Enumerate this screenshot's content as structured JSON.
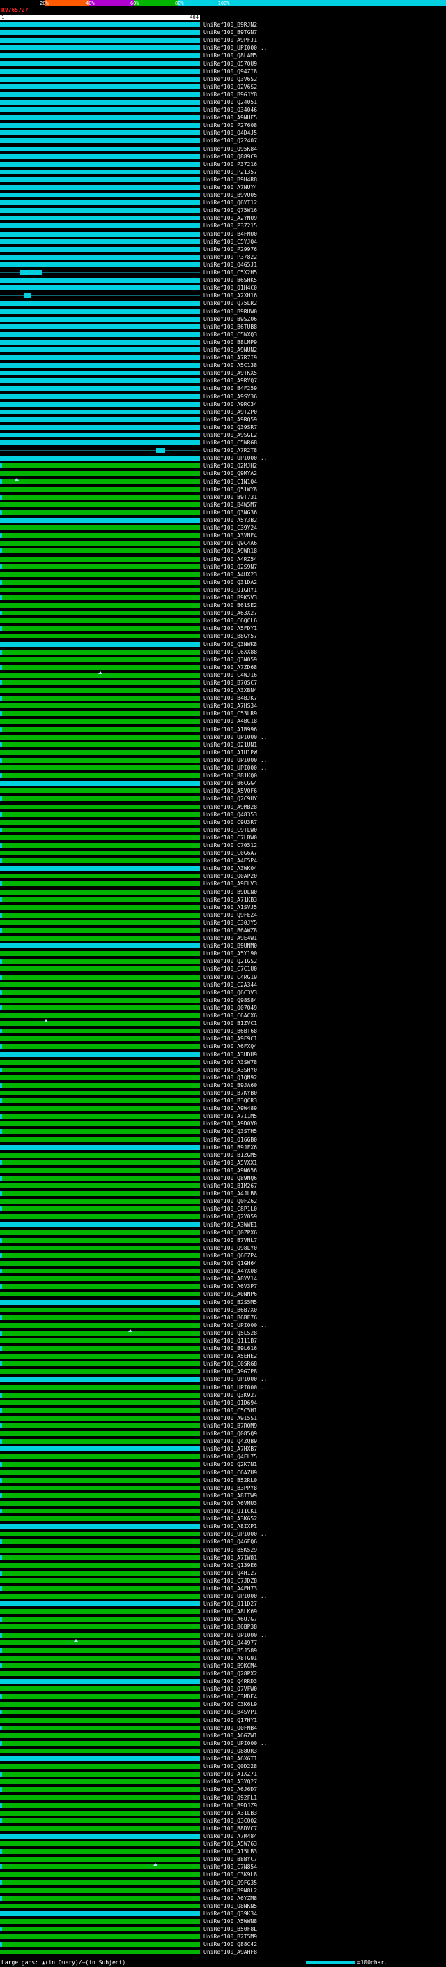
{
  "title": {
    "query_id": "RV765727",
    "query_start": "1",
    "query_end": "404"
  },
  "query_length": 404,
  "color_key": {
    "segments": [
      {
        "label": "20%",
        "color": "#000000"
      },
      {
        "label": "~40%",
        "color": "#ff5a00"
      },
      {
        "label": "~60%",
        "color": "#b000d0"
      },
      {
        "label": "~80%",
        "color": "#00b400"
      },
      {
        "label": "~100%",
        "color": "#00d0e0"
      }
    ]
  },
  "colors": {
    "c": "#00d0e0",
    "g": "#00b400",
    "m": "#c000c0",
    "n": "#0a6a74"
  },
  "footer": {
    "gap_legend": "Large gaps: ▲(in Query)/—(in Subject)",
    "scale_label": "=100char.",
    "scale_chars": 100
  },
  "rows": [
    {
      "id": "UniRef100_B9RJN2",
      "c": "c"
    },
    {
      "id": "UniRef100_B9TGN7",
      "c": "c"
    },
    {
      "id": "UniRef100_A9PFJ1",
      "c": "c"
    },
    {
      "id": "UniRef100_UPI000...",
      "c": "c"
    },
    {
      "id": "UniRef100_Q8LAM5",
      "c": "c"
    },
    {
      "id": "UniRef100_Q57OU9",
      "c": "c"
    },
    {
      "id": "UniRef100_Q94ZI8",
      "c": "c"
    },
    {
      "id": "UniRef100_Q3V6S2",
      "c": "c"
    },
    {
      "id": "UniRef100_Q2V6S2",
      "c": "c"
    },
    {
      "id": "UniRef100_B9GJY8",
      "c": "c"
    },
    {
      "id": "UniRef100_Q24051",
      "c": "c"
    },
    {
      "id": "UniRef100_Q34046",
      "c": "c"
    },
    {
      "id": "UniRef100_A9NUF5",
      "c": "c"
    },
    {
      "id": "UniRef100_P27608",
      "c": "c"
    },
    {
      "id": "UniRef100_Q4D4J5",
      "c": "c"
    },
    {
      "id": "UniRef100_Q22407",
      "c": "c"
    },
    {
      "id": "UniRef100_Q95K84",
      "c": "c"
    },
    {
      "id": "UniRef100_Q889C9",
      "c": "c"
    },
    {
      "id": "UniRef100_P37216",
      "c": "c"
    },
    {
      "id": "UniRef100_P21357",
      "c": "c"
    },
    {
      "id": "UniRef100_B9H4R8",
      "c": "c"
    },
    {
      "id": "UniRef100_A7NUY4",
      "c": "c"
    },
    {
      "id": "UniRef100_B9VU05",
      "c": "c"
    },
    {
      "id": "UniRef100_Q6YT12",
      "c": "c"
    },
    {
      "id": "UniRef100_Q75W16",
      "c": "c"
    },
    {
      "id": "UniRef100_A2YNU9",
      "c": "c"
    },
    {
      "id": "UniRef100_P37215",
      "c": "c"
    },
    {
      "id": "UniRef100_B4FMU0",
      "c": "c"
    },
    {
      "id": "UniRef100_C5YJQ4",
      "c": "c"
    },
    {
      "id": "UniRef100_P29976",
      "c": "c"
    },
    {
      "id": "UniRef100_P37822",
      "c": "c"
    },
    {
      "id": "UniRef100_Q4G5J1",
      "c": "c"
    },
    {
      "id": "UniRef100_C5X2H5",
      "c": "c",
      "s": [
        [
          1,
          39,
          "n"
        ],
        [
          40,
          85,
          "c"
        ],
        [
          86,
          404,
          "n"
        ]
      ]
    },
    {
      "id": "UniRef100_B6SHK5",
      "c": "c"
    },
    {
      "id": "UniRef100_Q1H4C0",
      "c": "c"
    },
    {
      "id": "UniRef100_A2XH16",
      "c": "c",
      "s": [
        [
          1,
          48,
          "n"
        ],
        [
          49,
          62,
          "c"
        ],
        [
          63,
          404,
          "n"
        ]
      ]
    },
    {
      "id": "UniRef100_Q75LR2",
      "c": "c"
    },
    {
      "id": "UniRef100_B9RUW0",
      "c": "c"
    },
    {
      "id": "UniRef100_B9SZ06",
      "c": "c"
    },
    {
      "id": "UniRef100_B6TUB8",
      "c": "c"
    },
    {
      "id": "UniRef100_C5WXQ3",
      "c": "c"
    },
    {
      "id": "UniRef100_B8LMP9",
      "c": "c"
    },
    {
      "id": "UniRef100_A9NUN2",
      "c": "c"
    },
    {
      "id": "UniRef100_A7R7I9",
      "c": "c"
    },
    {
      "id": "UniRef100_A5C138",
      "c": "c"
    },
    {
      "id": "UniRef100_A9TKX5",
      "c": "c"
    },
    {
      "id": "UniRef100_A9RYQ7",
      "c": "c"
    },
    {
      "id": "UniRef100_B4F259",
      "c": "c"
    },
    {
      "id": "UniRef100_A9SY36",
      "c": "c"
    },
    {
      "id": "UniRef100_A9RC34",
      "c": "c"
    },
    {
      "id": "UniRef100_A9TZP0",
      "c": "c"
    },
    {
      "id": "UniRef100_A9RQ59",
      "c": "c"
    },
    {
      "id": "UniRef100_Q39SR7",
      "c": "c"
    },
    {
      "id": "UniRef100_A9SGL2",
      "c": "c"
    },
    {
      "id": "UniRef100_C5WRG8",
      "c": "c"
    },
    {
      "id": "UniRef100_A7R2T8",
      "c": "c",
      "s": [
        [
          1,
          315,
          "n"
        ],
        [
          316,
          334,
          "c"
        ],
        [
          335,
          404,
          "n"
        ]
      ]
    },
    {
      "id": "UniRef100_UPI000...",
      "c": "c"
    },
    {
      "id": "UniRef100_Q2MJH2",
      "c": "g",
      "t": 1
    },
    {
      "id": "UniRef100_Q9MYA2",
      "c": "g"
    },
    {
      "id": "UniRef100_C1N1Q4",
      "c": "g",
      "t": 1,
      "m": 30
    },
    {
      "id": "UniRef100_Q51WY8",
      "c": "g"
    },
    {
      "id": "UniRef100_B9T731",
      "c": "g",
      "t": 1
    },
    {
      "id": "UniRef100_B4W5M7",
      "c": "g"
    },
    {
      "id": "UniRef100_Q3NG36",
      "c": "g",
      "t": 1
    },
    {
      "id": "UniRef100_A5Y3B2",
      "c": "c"
    },
    {
      "id": "UniRef100_C39Y24",
      "c": "g"
    },
    {
      "id": "UniRef100_A3VNF4",
      "c": "g",
      "t": 1
    },
    {
      "id": "UniRef100_Q9C4A6",
      "c": "g"
    },
    {
      "id": "UniRef100_A9WR18",
      "c": "g",
      "t": 1
    },
    {
      "id": "UniRef100_A4RZ54",
      "c": "g"
    },
    {
      "id": "UniRef100_Q2S9N7",
      "c": "g",
      "t": 1
    },
    {
      "id": "UniRef100_A4UX23",
      "c": "g"
    },
    {
      "id": "UniRef100_Q31DA2",
      "c": "g",
      "t": 1
    },
    {
      "id": "UniRef100_Q1GRY1",
      "c": "g"
    },
    {
      "id": "UniRef100_B9K5V3",
      "c": "g",
      "t": 1
    },
    {
      "id": "UniRef100_B61SE2",
      "c": "g"
    },
    {
      "id": "UniRef100_A63X27",
      "c": "g",
      "t": 1
    },
    {
      "id": "UniRef100_C6QCL6",
      "c": "g"
    },
    {
      "id": "UniRef100_A5FDY1",
      "c": "g",
      "t": 1
    },
    {
      "id": "UniRef100_B8GY57",
      "c": "g"
    },
    {
      "id": "UniRef100_Q3NWK8",
      "c": "c"
    },
    {
      "id": "UniRef100_C6XX88",
      "c": "g",
      "t": 1
    },
    {
      "id": "UniRef100_Q3N059",
      "c": "g"
    },
    {
      "id": "UniRef100_A7ZD68",
      "c": "g",
      "t": 1
    },
    {
      "id": "UniRef100_C4WJ16",
      "c": "g",
      "m": 200
    },
    {
      "id": "UniRef100_B7QSC7",
      "c": "g",
      "t": 1
    },
    {
      "id": "UniRef100_A3XBN4",
      "c": "g"
    },
    {
      "id": "UniRef100_B4BJK7",
      "c": "g",
      "t": 1
    },
    {
      "id": "UniRef100_A7HS34",
      "c": "g"
    },
    {
      "id": "UniRef100_C53LR9",
      "c": "g",
      "t": 1
    },
    {
      "id": "UniRef100_A4BC18",
      "c": "g"
    },
    {
      "id": "UniRef100_A1B996",
      "c": "g",
      "t": 1
    },
    {
      "id": "UniRef100_UPI000...",
      "c": "g"
    },
    {
      "id": "UniRef100_Q21UN1",
      "c": "g",
      "t": 1
    },
    {
      "id": "UniRef100_A1U1PW",
      "c": "g"
    },
    {
      "id": "UniRef100_UPI000...",
      "c": "g",
      "t": 1
    },
    {
      "id": "UniRef100_UPI000...",
      "c": "g"
    },
    {
      "id": "UniRef100_B81KQ0",
      "c": "g",
      "t": 1
    },
    {
      "id": "UniRef100_B6CGG4",
      "c": "c"
    },
    {
      "id": "UniRef100_A5VQF6",
      "c": "g"
    },
    {
      "id": "UniRef100_Q2C9UY",
      "c": "g",
      "t": 1
    },
    {
      "id": "UniRef100_A9MB28",
      "c": "g"
    },
    {
      "id": "UniRef100_Q48353",
      "c": "g",
      "t": 1
    },
    {
      "id": "UniRef100_C9U3R7",
      "c": "g"
    },
    {
      "id": "UniRef100_C9TLW0",
      "c": "g",
      "t": 1
    },
    {
      "id": "UniRef100_C7LBW0",
      "c": "g"
    },
    {
      "id": "UniRef100_C70512",
      "c": "g",
      "t": 1
    },
    {
      "id": "UniRef100_C0G6A7",
      "c": "g"
    },
    {
      "id": "UniRef100_A4E5P4",
      "c": "g",
      "t": 1
    },
    {
      "id": "UniRef100_A3WK04",
      "c": "c"
    },
    {
      "id": "UniRef100_Q0AP20",
      "c": "g"
    },
    {
      "id": "UniRef100_A9ELV3",
      "c": "g",
      "t": 1
    },
    {
      "id": "UniRef100_B9DLN0",
      "c": "g"
    },
    {
      "id": "UniRef100_A71KB3",
      "c": "g",
      "t": 1
    },
    {
      "id": "UniRef100_A1SVJ5",
      "c": "g"
    },
    {
      "id": "UniRef100_Q9FEZ4",
      "c": "g",
      "t": 1
    },
    {
      "id": "UniRef100_C30JY5",
      "c": "g"
    },
    {
      "id": "UniRef100_B6AWZ8",
      "c": "g",
      "t": 1
    },
    {
      "id": "UniRef100_A9E4W1",
      "c": "g"
    },
    {
      "id": "UniRef100_B9UNM0",
      "c": "c"
    },
    {
      "id": "UniRef100_A5Y190",
      "c": "g"
    },
    {
      "id": "UniRef100_Q21GS2",
      "c": "g",
      "t": 1
    },
    {
      "id": "UniRef100_C7C1U0",
      "c": "g"
    },
    {
      "id": "UniRef100_C4RG19",
      "c": "g",
      "t": 1
    },
    {
      "id": "UniRef100_C2A344",
      "c": "g"
    },
    {
      "id": "UniRef100_Q6C3V3",
      "c": "g",
      "t": 1
    },
    {
      "id": "UniRef100_Q98S84",
      "c": "g"
    },
    {
      "id": "UniRef100_Q07Q49",
      "c": "g",
      "t": 1
    },
    {
      "id": "UniRef100_C6ACX6",
      "c": "g"
    },
    {
      "id": "UniRef100_B1ZVC1",
      "c": "g",
      "m": 90
    },
    {
      "id": "UniRef100_B6BT68",
      "c": "g",
      "t": 1
    },
    {
      "id": "UniRef100_A9F9C1",
      "c": "g"
    },
    {
      "id": "UniRef100_A6FXQ4",
      "c": "g",
      "t": 1
    },
    {
      "id": "UniRef100_A3UDU9",
      "c": "c"
    },
    {
      "id": "UniRef100_A3SW78",
      "c": "g"
    },
    {
      "id": "UniRef100_A3SHY0",
      "c": "g",
      "t": 1
    },
    {
      "id": "UniRef100_Q1QN92",
      "c": "g"
    },
    {
      "id": "UniRef100_B9JA60",
      "c": "g",
      "t": 1
    },
    {
      "id": "UniRef100_B7KYB0",
      "c": "g"
    },
    {
      "id": "UniRef100_B3QCR3",
      "c": "g",
      "t": 1
    },
    {
      "id": "UniRef100_A9W489",
      "c": "g"
    },
    {
      "id": "UniRef100_A7I1M5",
      "c": "g",
      "t": 1
    },
    {
      "id": "UniRef100_A9D0V0",
      "c": "g"
    },
    {
      "id": "UniRef100_Q3STH5",
      "c": "g",
      "t": 1
    },
    {
      "id": "UniRef100_Q16GB0",
      "c": "g"
    },
    {
      "id": "UniRef100_B9JFX6",
      "c": "c"
    },
    {
      "id": "UniRef100_B1ZGM5",
      "c": "g"
    },
    {
      "id": "UniRef100_A5VXX1",
      "c": "g",
      "t": 1
    },
    {
      "id": "UniRef100_A9N656",
      "c": "g"
    },
    {
      "id": "UniRef100_Q89NQ6",
      "c": "g",
      "t": 1
    },
    {
      "id": "UniRef100_B1M267",
      "c": "g"
    },
    {
      "id": "UniRef100_A4JLB8",
      "c": "g",
      "t": 1
    },
    {
      "id": "UniRef100_Q0FZ62",
      "c": "g"
    },
    {
      "id": "UniRef100_C8P1L0",
      "c": "g",
      "t": 1
    },
    {
      "id": "UniRef100_Q2Y059",
      "c": "g"
    },
    {
      "id": "UniRef100_A3WWE1",
      "c": "c"
    },
    {
      "id": "UniRef100_Q0ZPX6",
      "c": "g"
    },
    {
      "id": "UniRef100_B7VNL7",
      "c": "g",
      "t": 1
    },
    {
      "id": "UniRef100_Q98LY0",
      "c": "g"
    },
    {
      "id": "UniRef100_Q6FZP4",
      "c": "g",
      "t": 1
    },
    {
      "id": "UniRef100_Q1GH64",
      "c": "g"
    },
    {
      "id": "UniRef100_A4YX08",
      "c": "g",
      "t": 1
    },
    {
      "id": "UniRef100_A8YV14",
      "c": "g"
    },
    {
      "id": "UniRef100_A6V3P7",
      "c": "g",
      "t": 1
    },
    {
      "id": "UniRef100_A0NNP6",
      "c": "g"
    },
    {
      "id": "UniRef100_B2S5M5",
      "c": "c"
    },
    {
      "id": "UniRef100_B6B7X0",
      "c": "g"
    },
    {
      "id": "UniRef100_B6BE76",
      "c": "g",
      "t": 1
    },
    {
      "id": "UniRef100_UPI000...",
      "c": "g"
    },
    {
      "id": "UniRef100_Q5LS28",
      "c": "g",
      "t": 1,
      "m": 260
    },
    {
      "id": "UniRef100_Q111B7",
      "c": "g"
    },
    {
      "id": "UniRef100_B9L616",
      "c": "g",
      "t": 1
    },
    {
      "id": "UniRef100_A5EHE2",
      "c": "g"
    },
    {
      "id": "UniRef100_C0SRG8",
      "c": "g",
      "t": 1
    },
    {
      "id": "UniRef100_A9G7P8",
      "c": "g"
    },
    {
      "id": "UniRef100_UPI000...",
      "c": "c"
    },
    {
      "id": "UniRef100_UPI000...",
      "c": "g"
    },
    {
      "id": "UniRef100_Q3K927",
      "c": "g",
      "t": 1
    },
    {
      "id": "UniRef100_Q1D694",
      "c": "g"
    },
    {
      "id": "UniRef100_C5C5H1",
      "c": "g",
      "t": 1
    },
    {
      "id": "UniRef100_A9I5S1",
      "c": "g"
    },
    {
      "id": "UniRef100_B7RQM9",
      "c": "g",
      "t": 1
    },
    {
      "id": "UniRef100_Q085Q9",
      "c": "g"
    },
    {
      "id": "UniRef100_Q4ZQB9",
      "c": "g",
      "t": 1
    },
    {
      "id": "UniRef100_A7HXB7",
      "c": "c"
    },
    {
      "id": "UniRef100_Q4FL75",
      "c": "g"
    },
    {
      "id": "UniRef100_Q2K7N1",
      "c": "g",
      "t": 1
    },
    {
      "id": "UniRef100_C6AZU9",
      "c": "g"
    },
    {
      "id": "UniRef100_B52RL0",
      "c": "g",
      "t": 1
    },
    {
      "id": "UniRef100_B3PPY8",
      "c": "g"
    },
    {
      "id": "UniRef100_A8ITW9",
      "c": "g",
      "t": 1
    },
    {
      "id": "UniRef100_A6VMU3",
      "c": "g"
    },
    {
      "id": "UniRef100_Q11CK1",
      "c": "g",
      "t": 1
    },
    {
      "id": "UniRef100_A3K652",
      "c": "g"
    },
    {
      "id": "UniRef100_A8IXP1",
      "c": "c"
    },
    {
      "id": "UniRef100_UPI000...",
      "c": "g"
    },
    {
      "id": "UniRef100_Q46FQ6",
      "c": "g",
      "t": 1
    },
    {
      "id": "UniRef100_B5K529",
      "c": "g"
    },
    {
      "id": "UniRef100_A7IW81",
      "c": "g",
      "t": 1
    },
    {
      "id": "UniRef100_Q139E6",
      "c": "g"
    },
    {
      "id": "UniRef100_Q4H127",
      "c": "g",
      "t": 1
    },
    {
      "id": "UniRef100_C7JDZ8",
      "c": "g"
    },
    {
      "id": "UniRef100_A4EH73",
      "c": "g",
      "t": 1
    },
    {
      "id": "UniRef100_UPI000...",
      "c": "g"
    },
    {
      "id": "UniRef100_Q11D27",
      "c": "c"
    },
    {
      "id": "UniRef100_A8LK69",
      "c": "g"
    },
    {
      "id": "UniRef100_A6U7G7",
      "c": "g",
      "t": 1
    },
    {
      "id": "UniRef100_B6BP38",
      "c": "g"
    },
    {
      "id": "UniRef100_UPI000...",
      "c": "g",
      "t": 1
    },
    {
      "id": "UniRef100_Q44977",
      "c": "g",
      "m": 150
    },
    {
      "id": "UniRef100_B5J589",
      "c": "g",
      "t": 1
    },
    {
      "id": "UniRef100_A8TG91",
      "c": "g"
    },
    {
      "id": "UniRef100_B9KCM4",
      "c": "g",
      "t": 1
    },
    {
      "id": "UniRef100_Q28PX2",
      "c": "g"
    },
    {
      "id": "UniRef100_Q4RRD3",
      "c": "c"
    },
    {
      "id": "UniRef100_Q7VFW0",
      "c": "g"
    },
    {
      "id": "UniRef100_C3MDE4",
      "c": "g",
      "t": 1
    },
    {
      "id": "UniRef100_C3K6L9",
      "c": "g"
    },
    {
      "id": "UniRef100_B4SVP1",
      "c": "g",
      "t": 1
    },
    {
      "id": "UniRef100_Q17HY1",
      "c": "g"
    },
    {
      "id": "UniRef100_Q0FMB4",
      "c": "g",
      "t": 1
    },
    {
      "id": "UniRef100_A6GZW1",
      "c": "g"
    },
    {
      "id": "UniRef100_UPI000...",
      "c": "g",
      "t": 1
    },
    {
      "id": "UniRef100_Q88UR3",
      "c": "g"
    },
    {
      "id": "UniRef100_A6X6T1",
      "c": "c"
    },
    {
      "id": "UniRef100_Q0D228",
      "c": "g"
    },
    {
      "id": "UniRef100_A1XZ71",
      "c": "g",
      "t": 1
    },
    {
      "id": "UniRef100_A3YQ27",
      "c": "g"
    },
    {
      "id": "UniRef100_A6J6D7",
      "c": "g",
      "t": 1
    },
    {
      "id": "UniRef100_Q92FL1",
      "c": "g"
    },
    {
      "id": "UniRef100_B9DJZ9",
      "c": "g",
      "t": 1
    },
    {
      "id": "UniRef100_A31LB3",
      "c": "g"
    },
    {
      "id": "UniRef100_Q3CQQ2",
      "c": "g",
      "t": 1
    },
    {
      "id": "UniRef100_B8DVC7",
      "c": "g"
    },
    {
      "id": "UniRef100_A7M484",
      "c": "c"
    },
    {
      "id": "UniRef100_A5W763",
      "c": "g"
    },
    {
      "id": "UniRef100_A15LB3",
      "c": "g",
      "t": 1
    },
    {
      "id": "UniRef100_B8BYC7",
      "c": "g"
    },
    {
      "id": "UniRef100_C7N854",
      "c": "g",
      "t": 1,
      "m": 310
    },
    {
      "id": "UniRef100_C3K9L8",
      "c": "g"
    },
    {
      "id": "UniRef100_Q9FG35",
      "c": "g",
      "t": 1
    },
    {
      "id": "UniRef100_B9N8L2",
      "c": "g"
    },
    {
      "id": "UniRef100_A6YZM8",
      "c": "g",
      "t": 1
    },
    {
      "id": "UniRef100_Q8NKN5",
      "c": "g"
    },
    {
      "id": "UniRef100_Q39K34",
      "c": "c"
    },
    {
      "id": "UniRef100_A5WWN8",
      "c": "g"
    },
    {
      "id": "UniRef100_B50F8L",
      "c": "g",
      "t": 1
    },
    {
      "id": "UniRef100_B2T5M9",
      "c": "g"
    },
    {
      "id": "UniRef100_Q88C42",
      "c": "g",
      "t": 1
    },
    {
      "id": "UniRef100_A9AHF8",
      "c": "g"
    }
  ]
}
